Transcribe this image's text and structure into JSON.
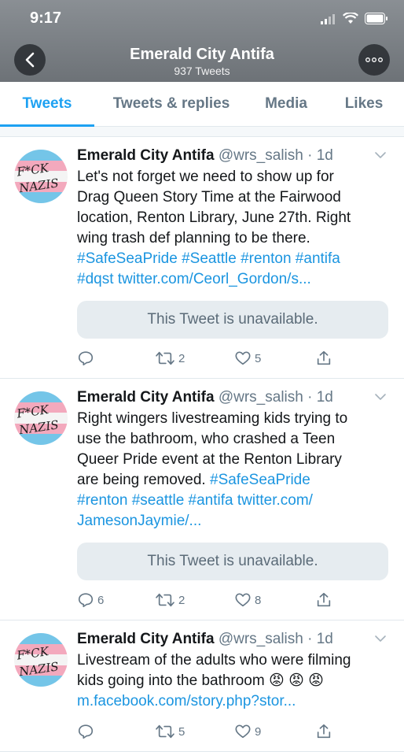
{
  "status_bar": {
    "time": "9:17"
  },
  "header": {
    "title": "Emerald City Antifa",
    "subtitle": "937 Tweets"
  },
  "tabs": [
    {
      "label": "Tweets",
      "active": true
    },
    {
      "label": "Tweets & replies"
    },
    {
      "label": "Media"
    },
    {
      "label": "Likes"
    }
  ],
  "avatar_text": [
    "F*CK",
    "NAZIS"
  ],
  "colors": {
    "accent": "#1da1f2",
    "link": "#1b95e0",
    "muted": "#657786"
  },
  "tweets": [
    {
      "name": "Emerald City Antifa",
      "handle": "@wrs_salish",
      "time": "· 1d",
      "body": "Let's not forget we need to show up for\nDrag Queen Story Time at the Fairwood\nlocation, Renton Library, June 27th. Right\nwing trash def planning to be there.",
      "links": "#SafeSeaPride #Seattle #renton #antifa\n#dqst twitter.com/Ceorl_Gordon/s...",
      "card": "This Tweet is unavailable.",
      "reply_count": "",
      "retweet_count": "2",
      "like_count": "5"
    },
    {
      "name": "Emerald City Antifa",
      "handle": "@wrs_salish",
      "time": "· 1d",
      "body": "Right wingers livestreaming kids trying to\nuse the bathroom, who crashed a Teen\nQueer Pride event at the Renton Library\nare being removed.",
      "links_inline": "#SafeSeaPride",
      "links": "#renton #seattle #antifa twitter.com/\nJamesonJaymie/...",
      "card": "This Tweet is unavailable.",
      "reply_count": "6",
      "retweet_count": "2",
      "like_count": "8"
    },
    {
      "name": "Emerald City Antifa",
      "handle": "@wrs_salish",
      "time": "· 1d",
      "body": "Livestream of the adults who were filming\nkids going into the bathroom",
      "emoji": "😡 😡 😡",
      "links": "m.facebook.com/story.php?stor...",
      "reply_count": "",
      "retweet_count": "5",
      "like_count": "9"
    }
  ]
}
